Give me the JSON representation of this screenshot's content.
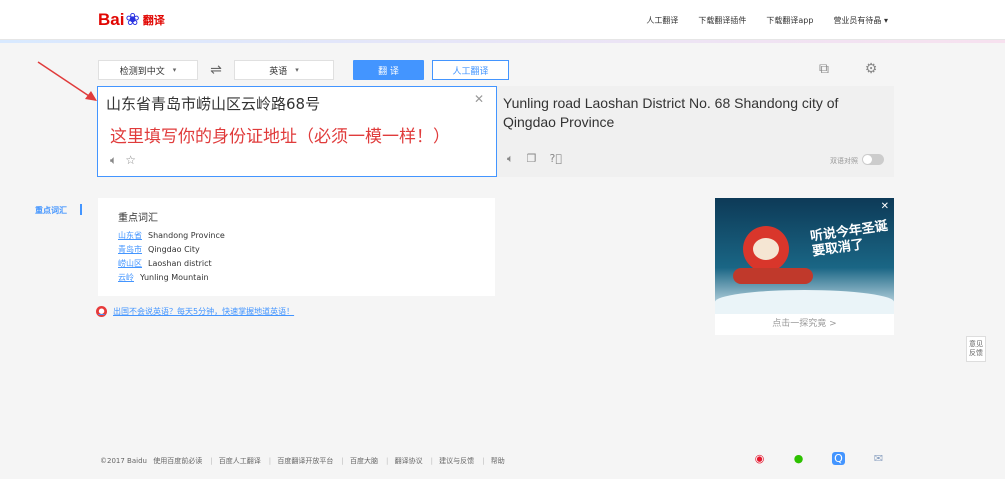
{
  "header": {
    "logo_text": "Bai",
    "logo_suffix": "翻译",
    "links": [
      "人工翻译",
      "下载翻译插件",
      "下载翻译app",
      "营业员有待晶 ▾"
    ]
  },
  "controls": {
    "source_lang": "检测到中文",
    "target_lang": "英语",
    "swap_symbol": "⇌",
    "translate_button": "翻 译",
    "human_button": "人工翻译"
  },
  "source": {
    "text": "山东省青岛市崂山区云岭路68号",
    "note": "这里填写你的身份证地址（必须一模一样！）"
  },
  "target": {
    "text": "Yunling road Laoshan District No. 68 Shandong city of Qingdao Province",
    "dual_label": "双语对照"
  },
  "vocab": {
    "side_label": "重点词汇",
    "title": "重点词汇",
    "items": [
      {
        "word": "山东省",
        "meaning": "Shandong Province"
      },
      {
        "word": "青岛市",
        "meaning": "Qingdao City"
      },
      {
        "word": "崂山区",
        "meaning": "Laoshan district"
      },
      {
        "word": "云岭",
        "meaning": "Yunling Mountain"
      }
    ]
  },
  "promo": {
    "text": "出国不会说英语？每天5分钟，快速掌握地道英语！"
  },
  "ad": {
    "slogan": "听说今年圣诞要取消了",
    "caption": "点击一探究竟 >"
  },
  "feedback": {
    "text": "意见反馈"
  },
  "footer": {
    "copyright": "©2017 Baidu",
    "links": [
      "使用百度前必读",
      "百度人工翻译",
      "百度翻译开放平台",
      "百度大脑",
      "翻译协议",
      "建议与反馈",
      "帮助"
    ]
  },
  "colors": {
    "accent": "#4395ff",
    "brand_red": "#e10602",
    "note_red": "#e03b3b"
  }
}
